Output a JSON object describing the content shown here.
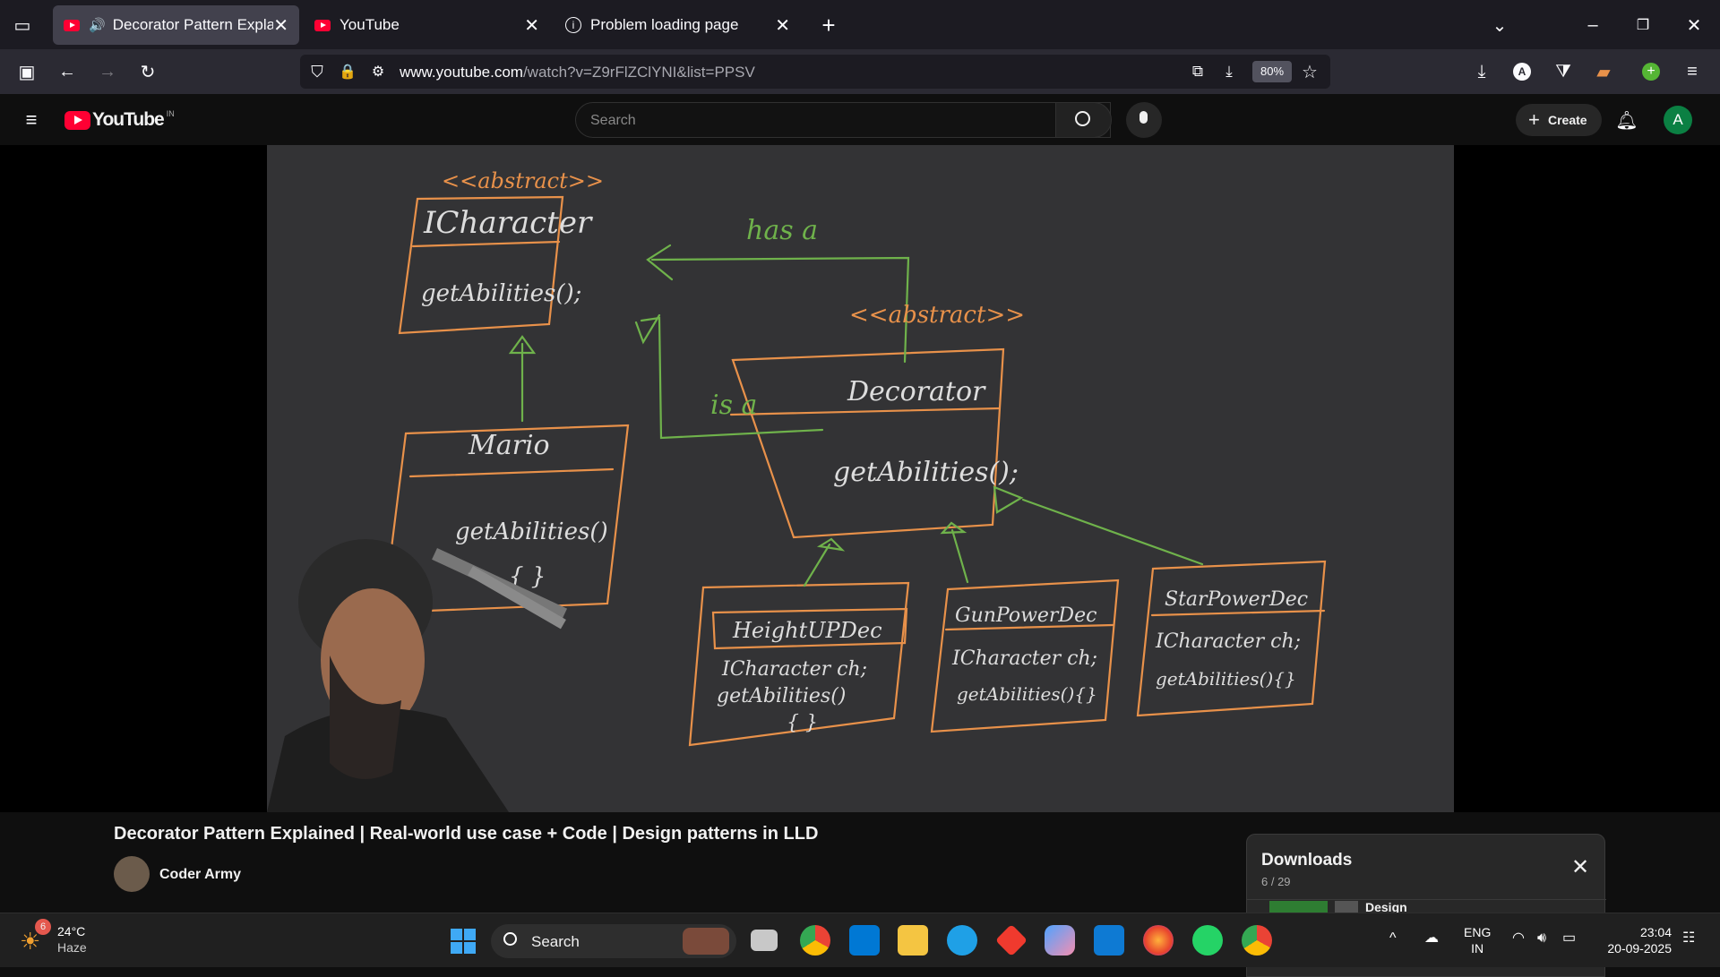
{
  "browser": {
    "tabs": [
      {
        "title": "Decorator Pattern Explainec",
        "active": true,
        "audio": true
      },
      {
        "title": "YouTube",
        "active": false
      },
      {
        "title": "Problem loading page",
        "active": false
      }
    ],
    "url_host": "www.youtube.com",
    "url_path": "/watch?v=Z9rFlZClYNI&list=PPSV",
    "zoom": "80%"
  },
  "youtube": {
    "logo_text": "YouTube",
    "region": "IN",
    "search_placeholder": "Search",
    "create_label": "Create",
    "avatar_letter": "A"
  },
  "video": {
    "whiteboard": {
      "abstract1": "<<abstract>>",
      "icharacter": "ICharacter",
      "icharacter_method": "getAbilities();",
      "has_a": "has a",
      "abstract2": "<<abstract>>",
      "mario": "Mario",
      "mario_method": "getAbilities()",
      "mario_body": "{ }",
      "is_a": "is a",
      "decorator": "Decorator",
      "decorator_method": "getAbilities();",
      "dec1": "HeightUPDec",
      "dec1_field": "ICharacter ch;",
      "dec1_method": "getAbilities()",
      "dec1_body": "{ }",
      "dec2": "GunPowerDec",
      "dec2_field": "ICharacter ch;",
      "dec2_method": "getAbilities(){}",
      "dec3": "StarPowerDec",
      "dec3_field": "ICharacter ch;",
      "dec3_method": "getAbilities(){}"
    }
  },
  "meta": {
    "title": "Decorator Pattern Explained | Real-world use case + Code | Design patterns in LLD",
    "channel": "Coder Army"
  },
  "downloads": {
    "heading": "Downloads",
    "count": "6 / 29",
    "item": "Design"
  },
  "taskbar": {
    "weather_temp": "24°C",
    "weather_desc": "Haze",
    "weather_badge": "6",
    "search_label": "Search",
    "lang1": "ENG",
    "lang2": "IN",
    "time": "23:04",
    "date": "20-09-2025"
  },
  "colors": {
    "youtube_red": "#ff0033",
    "chalk_orange": "#e8914a",
    "chalk_green": "#6fb24b"
  }
}
